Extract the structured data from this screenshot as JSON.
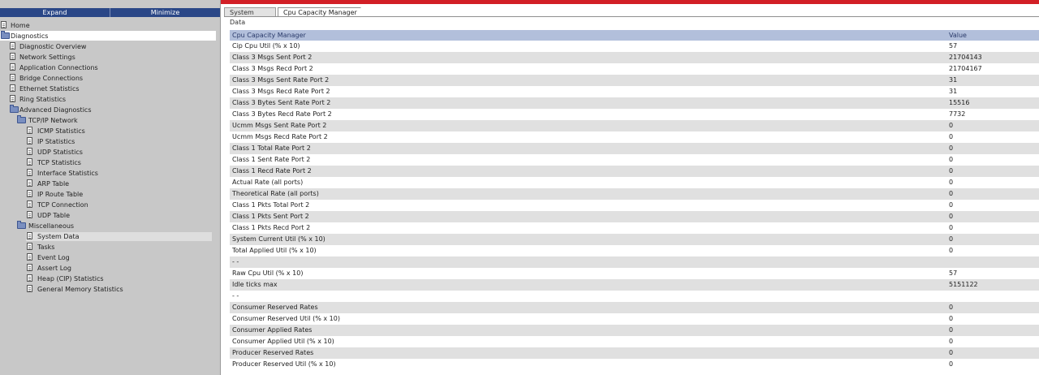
{
  "left_panel": {
    "expand_label": "Expand",
    "minimize_label": "Minimize",
    "tree": [
      {
        "label": "Home",
        "icon": "doc-icon",
        "level": 0
      },
      {
        "label": "Diagnostics",
        "icon": "folder-icon",
        "level": 0,
        "highlight": "white"
      },
      {
        "label": "Diagnostic Overview",
        "icon": "doc-icon",
        "level": 1
      },
      {
        "label": "Network Settings",
        "icon": "doc-icon",
        "level": 1
      },
      {
        "label": "Application Connections",
        "icon": "doc-icon",
        "level": 1
      },
      {
        "label": "Bridge Connections",
        "icon": "doc-icon",
        "level": 1
      },
      {
        "label": "Ethernet Statistics",
        "icon": "doc-icon",
        "level": 1
      },
      {
        "label": "Ring Statistics",
        "icon": "doc-icon",
        "level": 1
      },
      {
        "label": "Advanced Diagnostics",
        "icon": "folder-icon",
        "level": 1
      },
      {
        "label": "TCP/IP Network",
        "icon": "folder-icon",
        "level": 2
      },
      {
        "label": "ICMP Statistics",
        "icon": "doc-icon",
        "level": 3
      },
      {
        "label": "IP Statistics",
        "icon": "doc-icon",
        "level": 3
      },
      {
        "label": "UDP Statistics",
        "icon": "doc-icon",
        "level": 3
      },
      {
        "label": "TCP Statistics",
        "icon": "doc-icon",
        "level": 3
      },
      {
        "label": "Interface Statistics",
        "icon": "doc-icon",
        "level": 3
      },
      {
        "label": "ARP Table",
        "icon": "doc-icon",
        "level": 3
      },
      {
        "label": "IP Route Table",
        "icon": "doc-icon",
        "level": 3
      },
      {
        "label": "TCP Connection",
        "icon": "doc-icon",
        "level": 3
      },
      {
        "label": "UDP Table",
        "icon": "doc-icon",
        "level": 3
      },
      {
        "label": "Miscellaneous",
        "icon": "folder-icon",
        "level": 2
      },
      {
        "label": "System Data",
        "icon": "doc-icon",
        "level": 3,
        "highlight": "grey"
      },
      {
        "label": "Tasks",
        "icon": "doc-icon",
        "level": 3
      },
      {
        "label": "Event Log",
        "icon": "doc-icon",
        "level": 3
      },
      {
        "label": "Assert Log",
        "icon": "doc-icon",
        "level": 3
      },
      {
        "label": "Heap (CIP) Statistics",
        "icon": "doc-icon",
        "level": 3
      },
      {
        "label": "General Memory Statistics",
        "icon": "doc-icon",
        "level": 3
      }
    ]
  },
  "tabs": [
    {
      "label": "System Data",
      "active": false
    },
    {
      "label": "Cpu Capacity Manager",
      "active": true
    }
  ],
  "table": {
    "headers": [
      "Cpu Capacity Manager",
      "Value"
    ],
    "rows": [
      [
        "Cip Cpu Util (% x 10)",
        "57"
      ],
      [
        "Class 3 Msgs Sent Port 2",
        "21704143"
      ],
      [
        "Class 3 Msgs Recd Port 2",
        "21704167"
      ],
      [
        "Class 3 Msgs Sent Rate Port 2",
        "31"
      ],
      [
        "Class 3 Msgs Recd Rate Port 2",
        "31"
      ],
      [
        "Class 3 Bytes Sent Rate Port 2",
        "15516"
      ],
      [
        "Class 3 Bytes Recd Rate Port 2",
        "7732"
      ],
      [
        "Ucmm Msgs Sent Rate Port 2",
        "0"
      ],
      [
        "Ucmm Msgs Recd Rate Port 2",
        "0"
      ],
      [
        "Class 1 Total Rate Port 2",
        "0"
      ],
      [
        "Class 1 Sent Rate Port 2",
        "0"
      ],
      [
        "Class 1 Recd Rate Port 2",
        "0"
      ],
      [
        "Actual Rate (all ports)",
        "0"
      ],
      [
        "Theoretical Rate (all ports)",
        "0"
      ],
      [
        "Class 1 Pkts Total Port 2",
        "0"
      ],
      [
        "Class 1 Pkts Sent Port 2",
        "0"
      ],
      [
        "Class 1 Pkts Recd Port 2",
        "0"
      ],
      [
        "System Current Util (% x 10)",
        "0"
      ],
      [
        "Total Applied Util (% x 10)",
        "0"
      ],
      [
        "- -",
        ""
      ],
      [
        "Raw Cpu Util (% x 10)",
        "57"
      ],
      [
        "Idle ticks max",
        "5151122"
      ],
      [
        "- -",
        ""
      ],
      [
        "Consumer Reserved Rates",
        "0"
      ],
      [
        "Consumer Reserved Util (% x 10)",
        "0"
      ],
      [
        "Consumer Applied Rates",
        "0"
      ],
      [
        "Consumer Applied Util (% x 10)",
        "0"
      ],
      [
        "Producer Reserved Rates",
        "0"
      ],
      [
        "Producer Reserved Util (% x 10)",
        "0"
      ]
    ]
  }
}
